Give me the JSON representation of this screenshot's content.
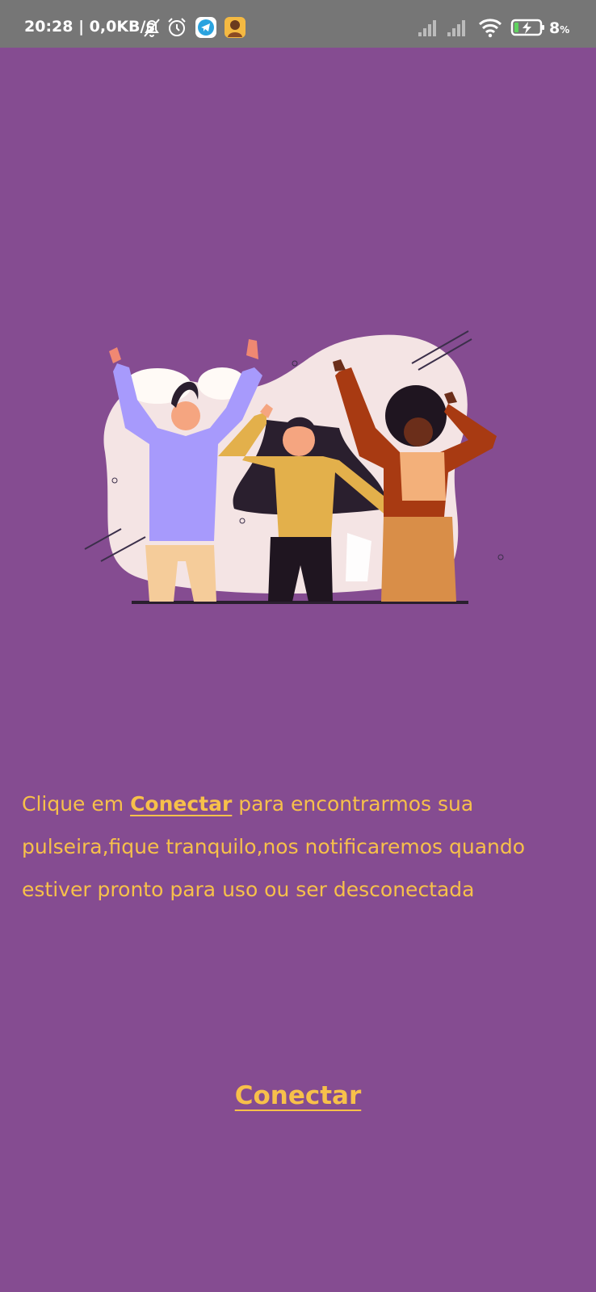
{
  "status_bar": {
    "time": "20:28",
    "network_speed": "0,0KB/s",
    "icons": [
      "notification-muted-icon",
      "alarm-icon",
      "telegram-icon",
      "app-avatar-icon"
    ],
    "right_icons": [
      "signal-icon",
      "signal-icon",
      "wifi-icon",
      "battery-charging-icon"
    ],
    "battery_value": "8",
    "battery_unit": "%",
    "background": "#767676"
  },
  "screen": {
    "background": "#854c91",
    "accent": "#f7c04a",
    "illustration": "people-celebrating-illustration",
    "instructions": {
      "before": "Clique em ",
      "link": "Conectar",
      "after": " para encontrarmos sua pulseira,fique tranquilo,nos notificaremos quando estiver pronto para uso ou ser desconectada"
    },
    "connect_label": "Conectar"
  }
}
